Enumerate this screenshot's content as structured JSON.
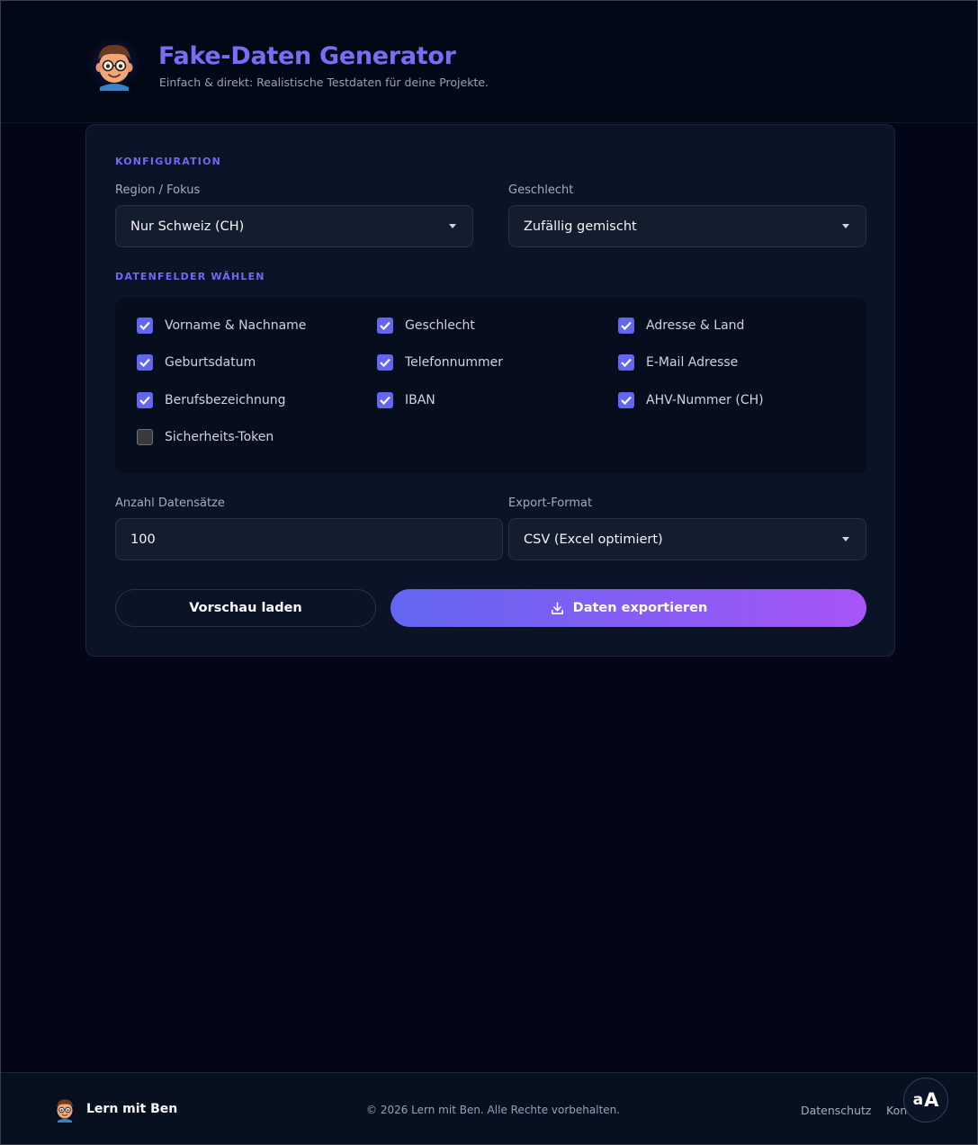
{
  "header": {
    "title": "Fake-Daten Generator",
    "subtitle": "Einfach & direkt: Realistische Testdaten für deine Projekte."
  },
  "config": {
    "section_label": "KONFIGURATION",
    "region_label": "Region / Fokus",
    "region_value": "Nur Schweiz (CH)",
    "gender_label": "Geschlecht",
    "gender_value": "Zufällig gemischt"
  },
  "fields": {
    "section_label": "DATENFELDER WÄHLEN",
    "items": [
      {
        "label": "Vorname & Nachname",
        "checked": true
      },
      {
        "label": "Geschlecht",
        "checked": true
      },
      {
        "label": "Adresse & Land",
        "checked": true
      },
      {
        "label": "Geburtsdatum",
        "checked": true
      },
      {
        "label": "Telefonnummer",
        "checked": true
      },
      {
        "label": "E-Mail Adresse",
        "checked": true
      },
      {
        "label": "Berufsbezeichnung",
        "checked": true
      },
      {
        "label": "IBAN",
        "checked": true
      },
      {
        "label": "AHV-Nummer (CH)",
        "checked": true
      },
      {
        "label": "Sicherheits-Token",
        "checked": false
      }
    ]
  },
  "output": {
    "count_label": "Anzahl Datensätze",
    "count_value": "100",
    "format_label": "Export-Format",
    "format_value": "CSV (Excel optimiert)"
  },
  "actions": {
    "preview_label": "Vorschau laden",
    "export_label": "Daten exportieren",
    "export_icon": "download-icon"
  },
  "footer": {
    "brand": "Lern mit Ben",
    "copyright": "© 2026 Lern mit Ben. Alle Rechte vorbehalten.",
    "links": [
      "Datenschutz",
      "Kon"
    ],
    "a11y_small": "a",
    "a11y_large": "A"
  },
  "colors": {
    "accent": "#6366f1",
    "accent_purple": "#a855f7",
    "background": "#020617",
    "card": "#0b1426"
  }
}
